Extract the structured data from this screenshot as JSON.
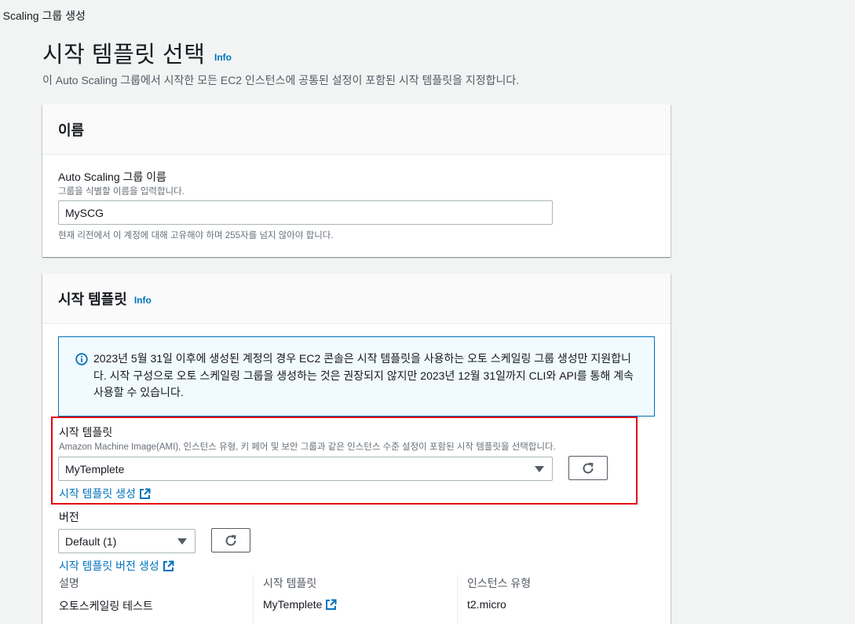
{
  "breadcrumb": "o Scaling 그룹 생성",
  "page": {
    "title": "시작 템플릿 선택",
    "info": "Info",
    "description": "이 Auto Scaling 그룹에서 시작한 모든 EC2 인스턴스에 공통된 설정이 포함된 시작 템플릿을 지정합니다."
  },
  "name_panel": {
    "header": "이름",
    "label": "Auto Scaling 그룹 이름",
    "description": "그룹을 식별할 이름을 입력합니다.",
    "value": "MySCG",
    "constraint": "현재 리전에서 이 계정에 대해 고유해야 하며 255자를 넘지 않아야 합니다."
  },
  "template_panel": {
    "header": "시작 템플릿",
    "info": "Info",
    "alert_text": "2023년 5월 31일 이후에 생성된 계정의 경우 EC2 콘솔은 시작 템플릿을 사용하는 오토 스케일링 그룹 생성만 지원합니다. 시작 구성으로 오토 스케일링 그룹을 생성하는 것은 권장되지 않지만 2023년 12월 31일까지 CLI와 API를 통해 계속 사용할 수 있습니다.",
    "template_label": "시작 템플릿",
    "template_description": "Amazon Machine Image(AMI), 인스턴스 유형, 키 페어 및 보안 그룹과 같은 인스턴스 수준 설정이 포함된 시작 템플릿을 선택합니다.",
    "template_selected": "MyTemplete",
    "create_template_link": "시작 템플릿 생성",
    "version_label": "버전",
    "version_selected": "Default (1)",
    "create_version_link": "시작 템플릿 버전 생성",
    "details": {
      "description_key": "설명",
      "description_value": "오토스케일링 테스트",
      "template_key": "시작 템플릿",
      "template_value": "MyTemplete",
      "instance_type_key": "인스턴스 유형",
      "instance_type_value": "t2.micro"
    }
  },
  "colors": {
    "link": "#0073bb",
    "highlight_border": "#e3000f",
    "alert_bg": "#f1faff"
  }
}
